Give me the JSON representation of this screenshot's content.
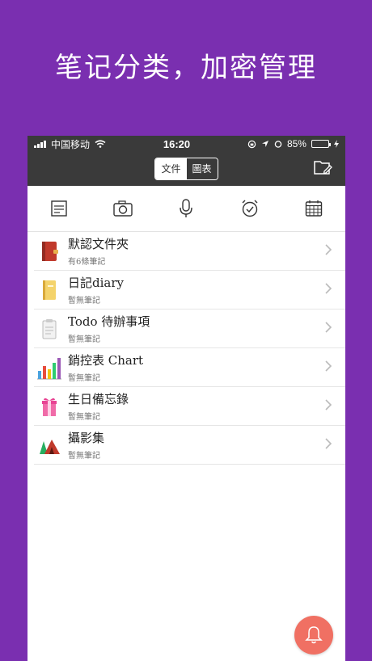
{
  "headline": "笔记分类，加密管理",
  "status": {
    "carrier": "中国移动",
    "time": "16:20",
    "battery": "85%",
    "battery_level": 0.85
  },
  "nav": {
    "tab_file": "文件",
    "tab_chart": "圖表",
    "selected_tab": "文件"
  },
  "toolbar": {
    "items": [
      "note-icon",
      "camera-icon",
      "microphone-icon",
      "alarm-icon",
      "calendar-icon"
    ]
  },
  "rows": [
    {
      "title": "默認文件夾",
      "sub": "有6條筆記",
      "icon": "folder-book-icon"
    },
    {
      "title": "日記diary",
      "sub": "暫無筆記",
      "icon": "diary-icon"
    },
    {
      "title": "Todo 待辦事項",
      "sub": "暫無筆記",
      "icon": "clipboard-icon"
    },
    {
      "title": "銷控表 Chart",
      "sub": "暫無筆記",
      "icon": "bar-chart-icon"
    },
    {
      "title": "生日備忘錄",
      "sub": "暫無筆記",
      "icon": "gift-icon"
    },
    {
      "title": "攝影集",
      "sub": "暫無筆記",
      "icon": "tent-icon"
    }
  ],
  "colors": {
    "background": "#7a2fb0",
    "bar": "#3a3a3a",
    "fab": "#f07063"
  }
}
